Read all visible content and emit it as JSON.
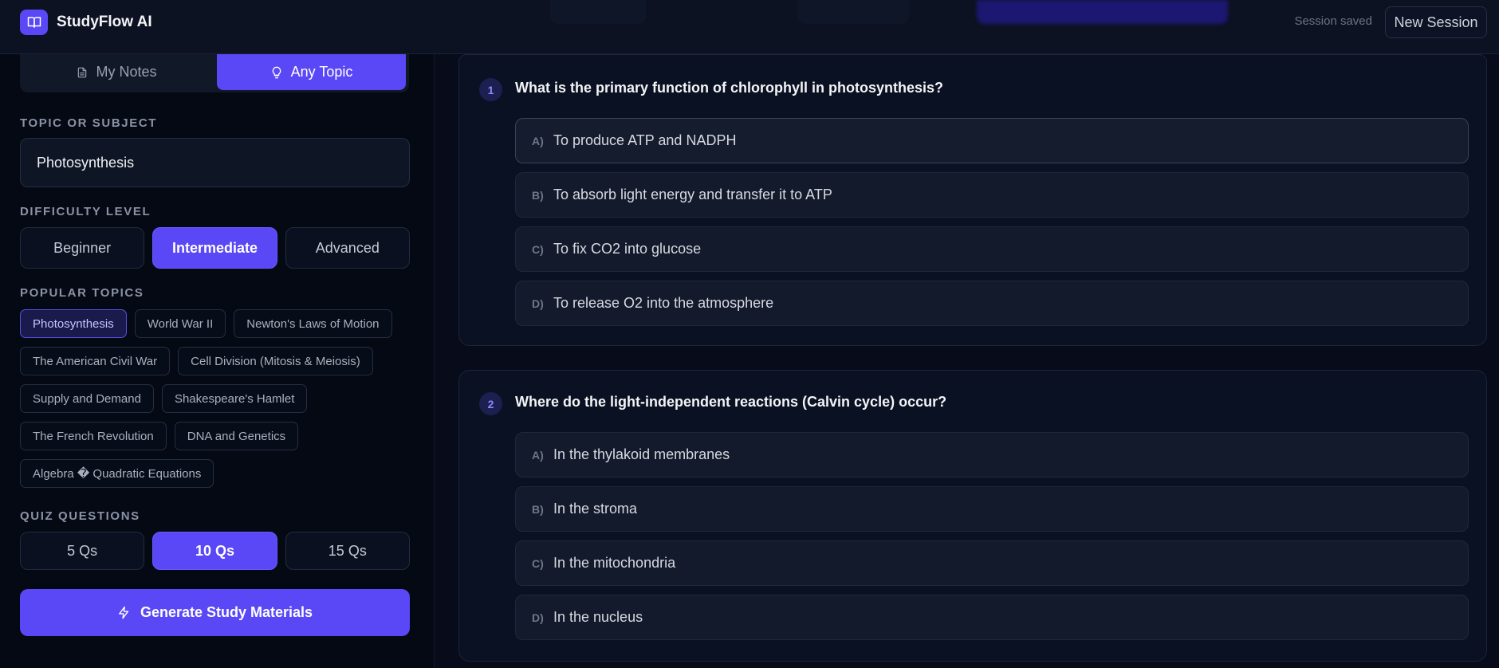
{
  "header": {
    "app_name": "StudyFlow AI",
    "logo_icon": "book-icon",
    "status": "Session saved",
    "new_session_label": "New Session"
  },
  "sidebar": {
    "mode_tabs": [
      {
        "label": "My Notes",
        "icon": "document-icon",
        "active": false
      },
      {
        "label": "Any Topic",
        "icon": "lightbulb-icon",
        "active": true
      }
    ],
    "topic_label": "TOPIC OR SUBJECT",
    "topic_value": "Photosynthesis",
    "difficulty_label": "DIFFICULTY LEVEL",
    "difficulty_options": [
      "Beginner",
      "Intermediate",
      "Advanced"
    ],
    "difficulty_selected": "Intermediate",
    "popular_label": "POPULAR TOPICS",
    "popular_topics": [
      "Photosynthesis",
      "World War II",
      "Newton's Laws of Motion",
      "The American Civil War",
      "Cell Division (Mitosis & Meiosis)",
      "Supply and Demand",
      "Shakespeare's Hamlet",
      "The French Revolution",
      "DNA and Genetics",
      "Algebra � Quadratic Equations"
    ],
    "popular_selected": "Photosynthesis",
    "quiz_label": "QUIZ QUESTIONS",
    "quiz_options": [
      "5 Qs",
      "10 Qs",
      "15 Qs"
    ],
    "quiz_selected": "10 Qs",
    "generate_label": "Generate Study Materials",
    "generate_icon": "lightning-icon"
  },
  "questions": [
    {
      "number": "1",
      "text": "What is the primary function of chlorophyll in photosynthesis?",
      "options": [
        {
          "letter": "A)",
          "text": "To produce ATP and NADPH"
        },
        {
          "letter": "B)",
          "text": "To absorb light energy and transfer it to ATP"
        },
        {
          "letter": "C)",
          "text": "To fix CO2 into glucose"
        },
        {
          "letter": "D)",
          "text": "To release O2 into the atmosphere"
        }
      ]
    },
    {
      "number": "2",
      "text": "Where do the light-independent reactions (Calvin cycle) occur?",
      "options": [
        {
          "letter": "A)",
          "text": "In the thylakoid membranes"
        },
        {
          "letter": "B)",
          "text": "In the stroma"
        },
        {
          "letter": "C)",
          "text": "In the mitochondria"
        },
        {
          "letter": "D)",
          "text": "In the nucleus"
        }
      ]
    }
  ],
  "colors": {
    "accent": "#5a47f6",
    "background": "#070b1a",
    "card": "#0a1122"
  }
}
